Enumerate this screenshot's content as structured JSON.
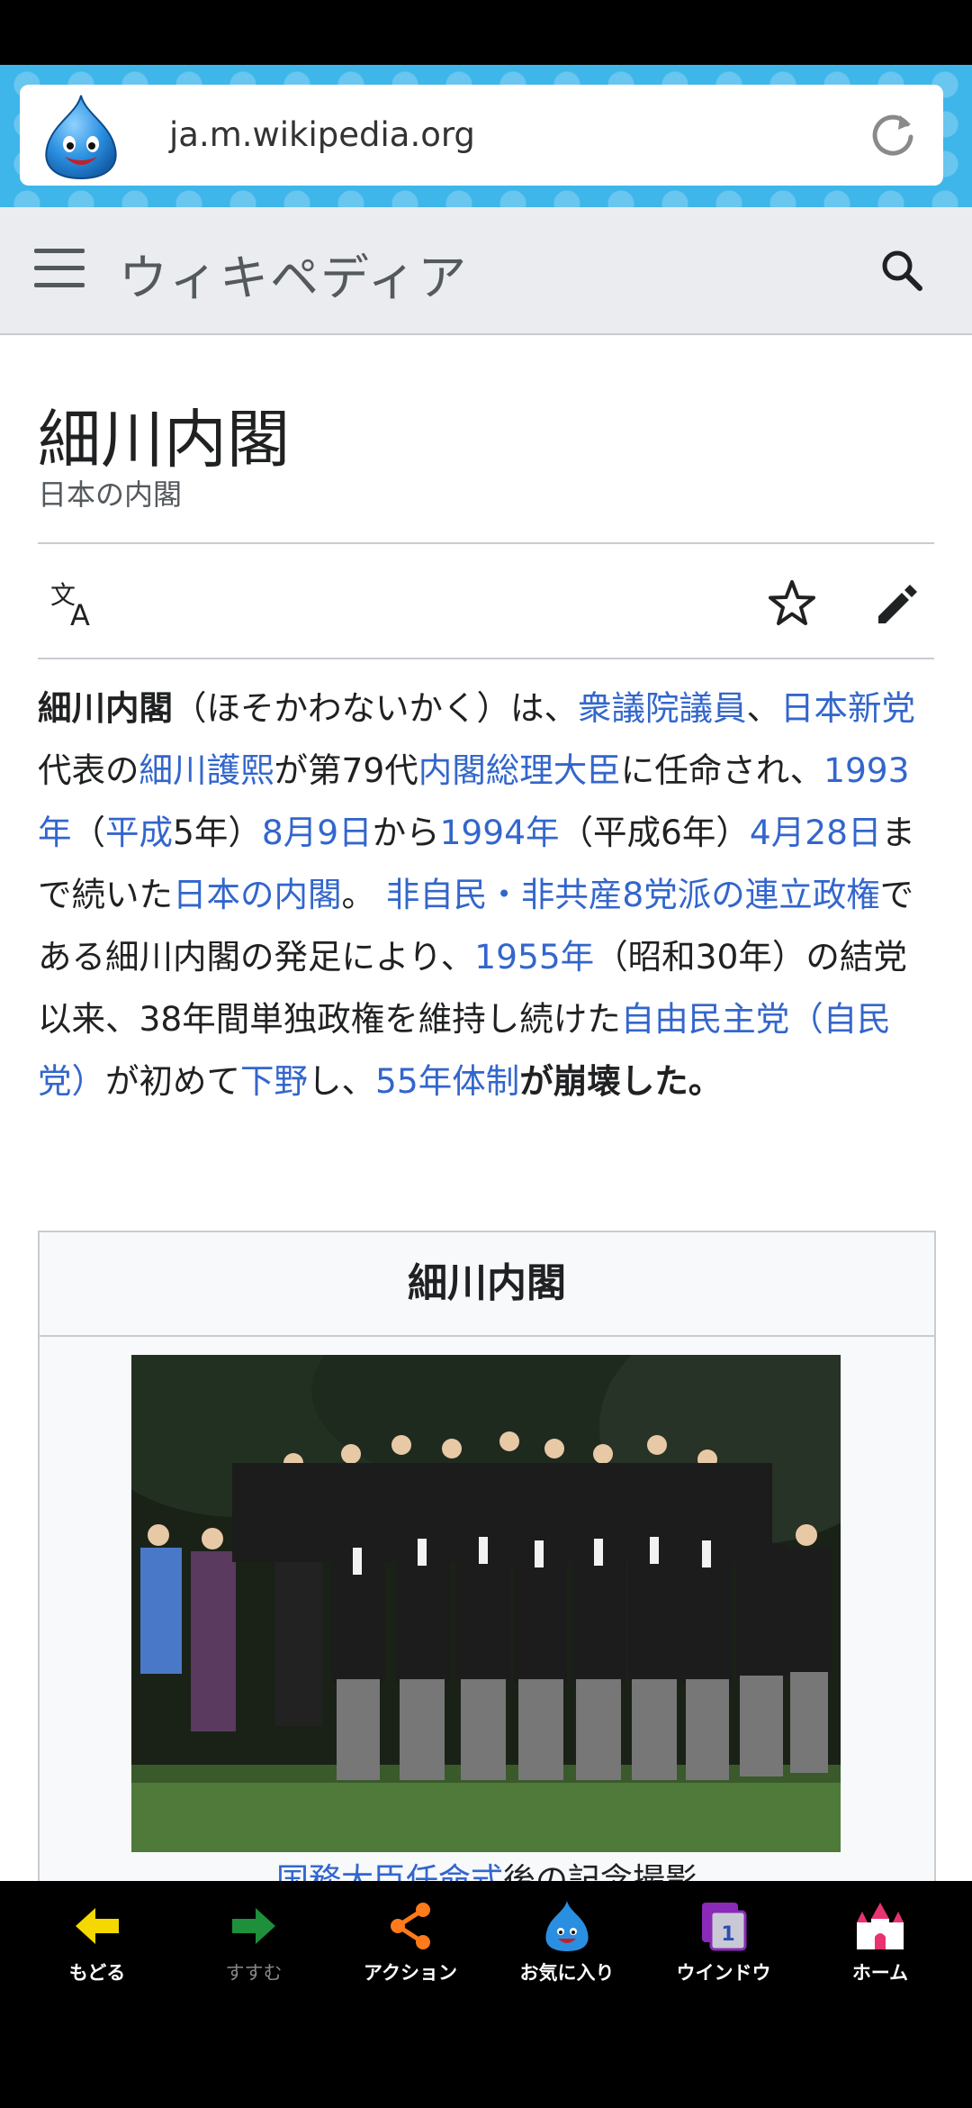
{
  "browser": {
    "url": "ja.m.wikipedia.org"
  },
  "wiki_header": {
    "wordmark": "ウィキペディア"
  },
  "article": {
    "title": "細川内閣",
    "description": "日本の内閣",
    "lead": {
      "t1": "細川内閣",
      "t2": "（ほそかわないかく）は、",
      "l1": "衆議院議員",
      "t3": "、",
      "l2": "日本新党",
      "t4": "代表の",
      "l3": "細川護熙",
      "t5": "が第79代",
      "l4": "内閣総理大臣",
      "t6": "に任命され、",
      "l5": "1993年",
      "t7": "（",
      "l6": "平成",
      "t8": "5年）",
      "l7": "8月9日",
      "t9": "から",
      "l8": "1994年",
      "t10": "（平成6年）",
      "l9": "4月28日",
      "t11": "まで続いた",
      "l10": "日本の内閣",
      "t12": "。",
      "l11": "非自民・非共産8党派の連立政権",
      "t13": "である細川内閣の発足により、",
      "l12": "1955年",
      "t14": "（昭和30年）の結党以来、38年間単独政権を維持し続けた",
      "l13": "自由民主党（自民党）",
      "t15": "が初めて",
      "l14": "下野",
      "t16": "し、",
      "l15": "55年体制",
      "t17": "が崩壊した。"
    },
    "infobox": {
      "title": "細川内閣",
      "caption_link": "国務大臣任命式",
      "caption_text": "後の記念撮影"
    }
  },
  "bottom_nav": [
    {
      "label": "もどる",
      "icon": "arrow-left-icon",
      "color": "#f5d800"
    },
    {
      "label": "すすむ",
      "icon": "arrow-right-icon",
      "color": "#1e8f3a"
    },
    {
      "label": "アクション",
      "icon": "share-icon",
      "color": "#ff7a1a"
    },
    {
      "label": "お気に入り",
      "icon": "slime-icon",
      "color": "#2a8fe0"
    },
    {
      "label": "ウインドウ",
      "icon": "window-icon",
      "color": "#8a2ab8",
      "badge": "1"
    },
    {
      "label": "ホーム",
      "icon": "castle-icon",
      "color": "#e8336e"
    }
  ],
  "colors": {
    "link": "#3366cc",
    "url_bar_bg": "#3fb6ea",
    "wiki_header_bg": "#eaecf0"
  }
}
